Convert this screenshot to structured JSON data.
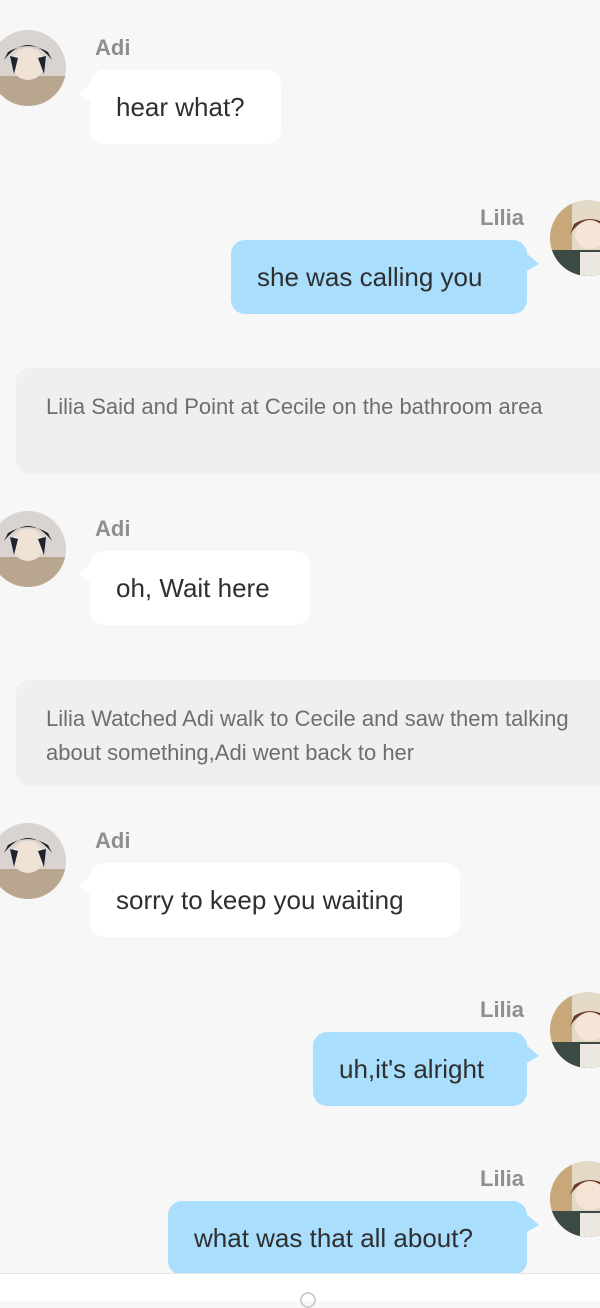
{
  "messages": [
    {
      "type": "incoming",
      "sender": "Adi",
      "avatar": "adi-avatar",
      "text": "hear what?"
    },
    {
      "type": "outgoing",
      "sender": "Lilia",
      "avatar": "lilia-avatar",
      "text": "she was calling you"
    },
    {
      "type": "narration",
      "text": "Lilia Said and Point at Cecile on the bathroom area"
    },
    {
      "type": "incoming",
      "sender": "Adi",
      "avatar": "adi-avatar",
      "text": "oh, Wait here"
    },
    {
      "type": "narration",
      "text": "Lilia Watched Adi walk to Cecile and saw them talking about something,Adi went back to her"
    },
    {
      "type": "incoming",
      "sender": "Adi",
      "avatar": "adi-avatar",
      "text": "sorry to keep you waiting"
    },
    {
      "type": "outgoing",
      "sender": "Lilia",
      "avatar": "lilia-avatar",
      "text": "uh,it's alright"
    },
    {
      "type": "outgoing",
      "sender": "Lilia",
      "avatar": "lilia-avatar",
      "text": "what was that all about?"
    }
  ],
  "colors": {
    "background": "#f7f7f7",
    "incoming_bubble": "#ffffff",
    "outgoing_bubble": "#a9defd",
    "narration_bubble": "#efefef",
    "sender_name": "#8f8f8f"
  }
}
